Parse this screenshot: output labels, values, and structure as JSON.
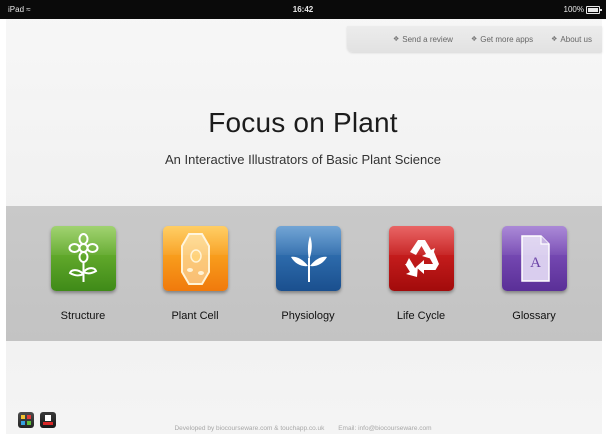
{
  "status_bar": {
    "device": "iPad",
    "wifi_icon": "wifi-icon",
    "time": "16:42",
    "battery_text": "100%"
  },
  "top_links": [
    {
      "label": "Send a review",
      "icon": "diamond-icon"
    },
    {
      "label": "Get more apps",
      "icon": "diamond-icon"
    },
    {
      "label": "About us",
      "icon": "diamond-icon"
    }
  ],
  "main": {
    "title": "Focus on Plant",
    "subtitle": "An Interactive Illustrators of Basic Plant Science"
  },
  "tiles": [
    {
      "label": "Structure",
      "icon": "flower-icon",
      "color": "#5aa628"
    },
    {
      "label": "Plant Cell",
      "icon": "plant-cell-icon",
      "color": "#f79a1b"
    },
    {
      "label": "Physiology",
      "icon": "sprout-icon",
      "color": "#2c68a9"
    },
    {
      "label": "Life Cycle",
      "icon": "recycle-icon",
      "color": "#c41818"
    },
    {
      "label": "Glossary",
      "icon": "glossary-icon",
      "color": "#7446af"
    }
  ],
  "footer": {
    "developer": "Developed by biocourseware.com & touchapp.co.uk",
    "email": "Email: info@biocourseware.com"
  },
  "bottom_icons": [
    "apps-icon",
    "share-icon"
  ]
}
